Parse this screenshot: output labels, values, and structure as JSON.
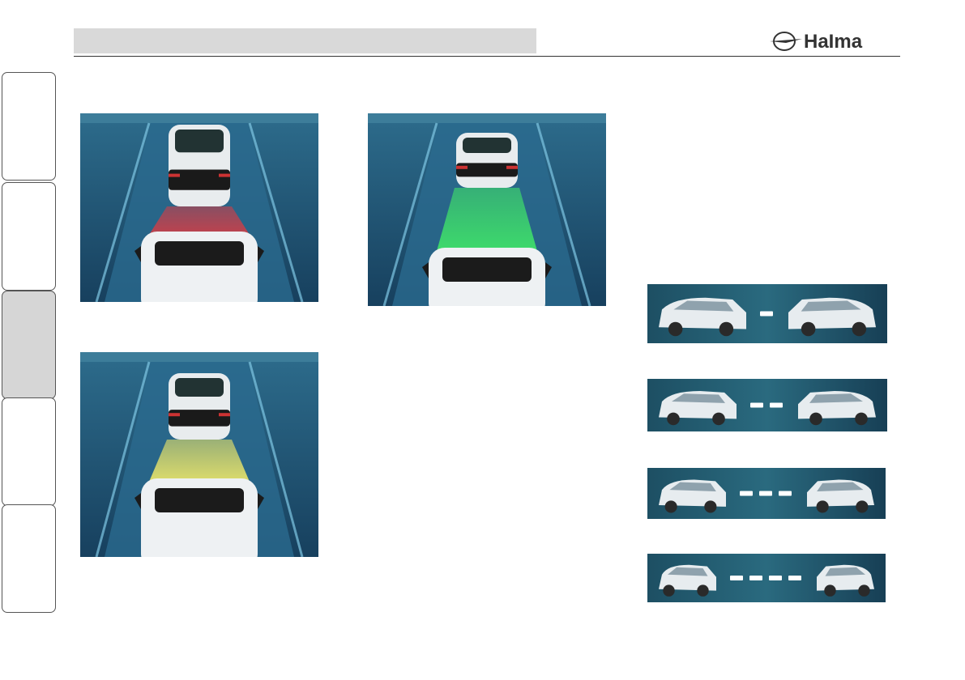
{
  "header": {
    "brand_icon": "haima-swallow-logo",
    "brand_text": "HaIma"
  },
  "side_tabs": [
    {
      "active": false
    },
    {
      "active": false
    },
    {
      "active": true
    },
    {
      "active": false
    },
    {
      "active": false
    }
  ],
  "figures": {
    "zone_colors": {
      "close": "#c8404a",
      "medium": "#e6e26a",
      "far": "#3fe06a"
    },
    "distance_strips": [
      {
        "bars": 1
      },
      {
        "bars": 2
      },
      {
        "bars": 3
      },
      {
        "bars": 4
      }
    ]
  }
}
